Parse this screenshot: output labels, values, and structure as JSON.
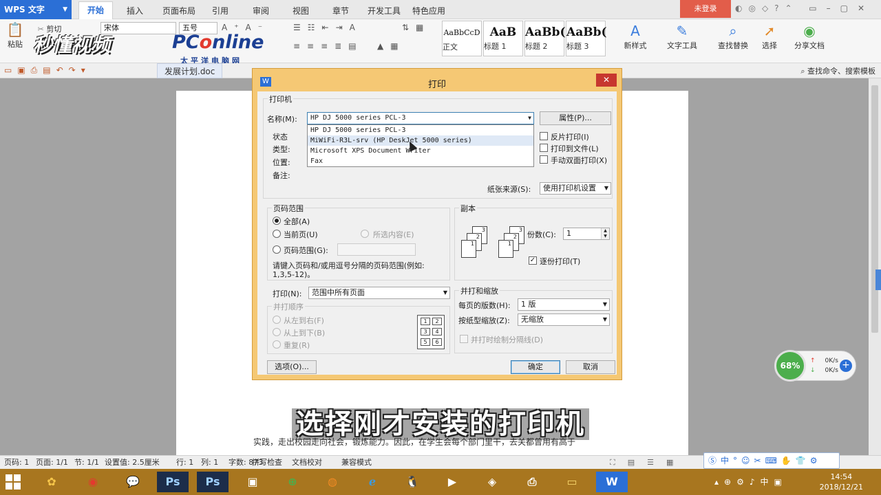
{
  "app": {
    "logo": "WPS 文字",
    "tabs": [
      "开始",
      "插入",
      "页面布局",
      "引用",
      "审阅",
      "视图",
      "章节",
      "开发工具",
      "特色应用"
    ],
    "login": "未登录"
  },
  "ribbon": {
    "paste": "粘贴",
    "cut": "剪切",
    "font_name": "宋体",
    "font_size": "五号",
    "styles": [
      {
        "preview": "AaBbCcD",
        "label": "正文"
      },
      {
        "preview": "AaB",
        "label": "标题 1"
      },
      {
        "preview": "AaBb(",
        "label": "标题 2"
      },
      {
        "preview": "AaBb(",
        "label": "标题 3"
      }
    ],
    "new_style": "新样式",
    "text_tools": "文字工具",
    "find_replace": "查找替换",
    "select": "选择",
    "share": "分享文档"
  },
  "watermark": {
    "line1": "秒懂视频",
    "brand_pc": "PC",
    "brand_o": "o",
    "brand_rest": "nline",
    "line3": "太平洋电脑网"
  },
  "qbar": {
    "doc_tab": "发展计划.doc",
    "search": "查找命令、搜索模板"
  },
  "dialog": {
    "title": "打印",
    "close": "✕",
    "printer_group": "打印机",
    "name_label": "名称(M):",
    "name_value": "HP DJ 5000 series PCL-3",
    "properties_btn": "属性(P)...",
    "status_label": "状态",
    "type_label": "类型:",
    "location_label": "位置:",
    "note_label": "备注:",
    "dropdown_options": [
      "HP DJ 5000 series PCL-3",
      "MiWiFi-R3L-srv (HP DeskJet 5000 series)",
      "Microsoft XPS Document Writer",
      "Fax"
    ],
    "reverse_print": "反片打印(I)",
    "print_to_file": "打印到文件(L)",
    "manual_duplex": "手动双面打印(X)",
    "paper_source_label": "纸张来源(S):",
    "paper_source_value": "使用打印机设置",
    "page_range_group": "页码范围",
    "all": "全部(A)",
    "current_page": "当前页(U)",
    "selection": "所选内容(E)",
    "page_range": "页码范围(G):",
    "range_hint": "请键入页码和/或用逗号分隔的页码范围(例如:",
    "range_hint2": "1,3,5-12)。",
    "print_label": "打印(N):",
    "print_value": "范围中所有页面",
    "order_group": "并打顺序",
    "left_to_right": "从左到右(F)",
    "top_to_bottom": "从上到下(B)",
    "repeat": "重复(R)",
    "copies_group": "副本",
    "copies_label": "份数(C):",
    "copies_value": "1",
    "collate": "逐份打印(T)",
    "zoom_group": "并打和缩放",
    "pages_per_sheet_label": "每页的版数(H):",
    "pages_per_sheet_value": "1 版",
    "scale_label": "按纸型缩放(Z):",
    "scale_value": "无缩放",
    "draw_separator": "并打时绘制分隔线(D)",
    "options_btn": "选项(O)...",
    "ok_btn": "确定",
    "cancel_btn": "取消",
    "copy_icon_nums": [
      "3",
      "2",
      "1"
    ],
    "order_nums": [
      "1",
      "2",
      "3",
      "4",
      "5",
      "6"
    ]
  },
  "page_text": "实践，走出校园走向社会，锻炼能力。因此，在学生会每个部门里干，去关都曾用有高于",
  "statusbar": {
    "page_no": "页码: 1",
    "pages": "页面: 1/1",
    "section": "节: 1/1",
    "settings": "设置值: 2.5厘米",
    "row": "行: 1",
    "col": "列: 1",
    "words": "字数: 873",
    "spell": "拼写检查",
    "proof": "文档校对",
    "compat": "兼容模式"
  },
  "netwidget": {
    "percent": "68%",
    "up": "0K/s",
    "down": "0K/s"
  },
  "taskbar": {
    "time": "14:54",
    "date": "2018/12/21"
  },
  "subtitle": "选择刚才安装的打印机"
}
